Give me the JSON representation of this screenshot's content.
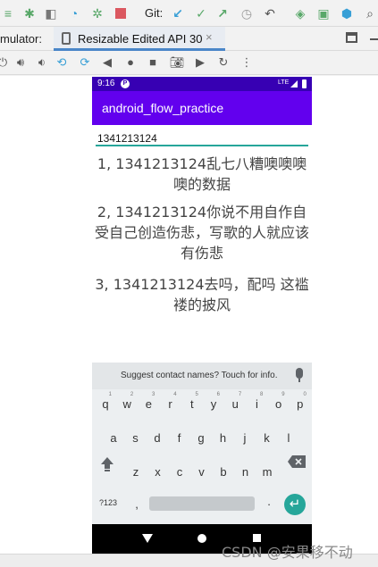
{
  "ide": {
    "toolbar": {
      "git_label": "Git:",
      "icons": [
        "stop-run-icon",
        "debug-icon",
        "attach-debugger-icon",
        "profile-icon",
        "apply-changes-icon",
        "stop-icon",
        "git-update-icon",
        "git-commit-icon",
        "git-push-icon",
        "history-icon",
        "rollback-icon",
        "device-manager-icon",
        "sdk-manager-icon",
        "structure-icon",
        "search-icon"
      ]
    },
    "tab_row": {
      "prefix_label": "mulator:",
      "tab_title": "Resizable Edited API 30",
      "close_label": "×"
    },
    "controls": [
      "power-icon",
      "volume-up-icon",
      "volume-down-icon",
      "rotate-left-icon",
      "rotate-right-icon",
      "back-icon",
      "home-icon",
      "overview-icon",
      "screenshot-icon",
      "record-icon",
      "snapshot-icon",
      "more-icon"
    ]
  },
  "phone": {
    "status_bar": {
      "time": "9:16",
      "app_indicator": "P",
      "network": "LTE"
    },
    "app_bar": {
      "title": "android_flow_practice"
    },
    "input": {
      "value": "1341213124"
    },
    "results": [
      "1, 1341213124乱七八糟噢噢噢噢的数据",
      "2, 1341213124你说不用自作自受自己创造伤悲，写歌的人就应该有伤悲",
      "3, 1341213124去吗，配吗 这褴褛的披风"
    ],
    "keyboard": {
      "suggestion": "Suggest contact names? Touch for info.",
      "row1": [
        "q",
        "w",
        "e",
        "r",
        "t",
        "y",
        "u",
        "i",
        "o",
        "p"
      ],
      "row1_hints": [
        "1",
        "2",
        "3",
        "4",
        "5",
        "6",
        "7",
        "8",
        "9",
        "0"
      ],
      "row2": [
        "a",
        "s",
        "d",
        "f",
        "g",
        "h",
        "j",
        "k",
        "l"
      ],
      "row3": [
        "z",
        "x",
        "c",
        "v",
        "b",
        "n",
        "m"
      ],
      "symbols_label": "?123",
      "comma": ",",
      "period": ".",
      "enter_icon": "enter-icon"
    }
  },
  "watermark": "CSDN @安果移不动",
  "colors": {
    "status_bar": "#3700b3",
    "app_bar": "#6200ee",
    "accent": "#26a69a"
  }
}
